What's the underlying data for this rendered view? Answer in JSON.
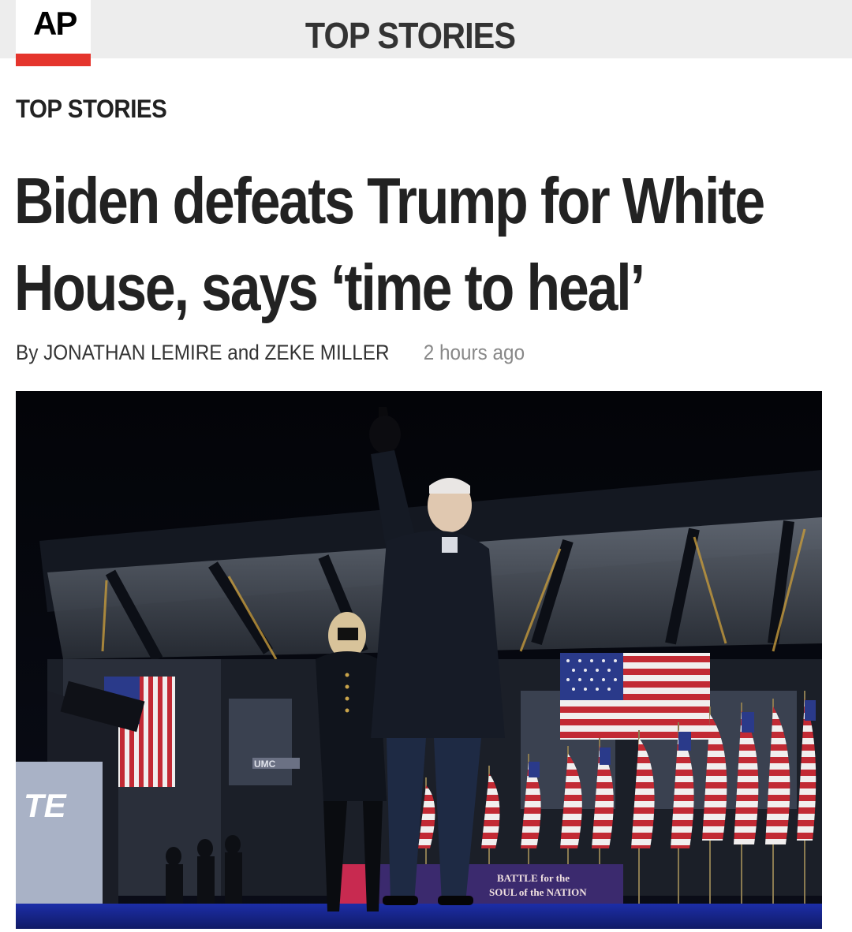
{
  "header": {
    "logo": "AP",
    "title": "TOP STORIES"
  },
  "section": {
    "label": "TOP STORIES"
  },
  "article": {
    "headline": "Biden defeats Trump for White House, says ‘time to heal’",
    "byline": "By JONATHAN LEMIRE and ZEKE MILLER",
    "timestamp": "2 hours ago"
  },
  "hero_image": {
    "description_icon": "photo",
    "sign_left": "TE",
    "stadium_sign": "UMC",
    "banner_text_1": "BATTLE for the",
    "banner_text_2": "SOUL of the NATION"
  },
  "colors": {
    "header_bg": "#ededed",
    "ap_red": "#e5352d",
    "text_dark": "#222222",
    "timestamp_gray": "#888888"
  }
}
